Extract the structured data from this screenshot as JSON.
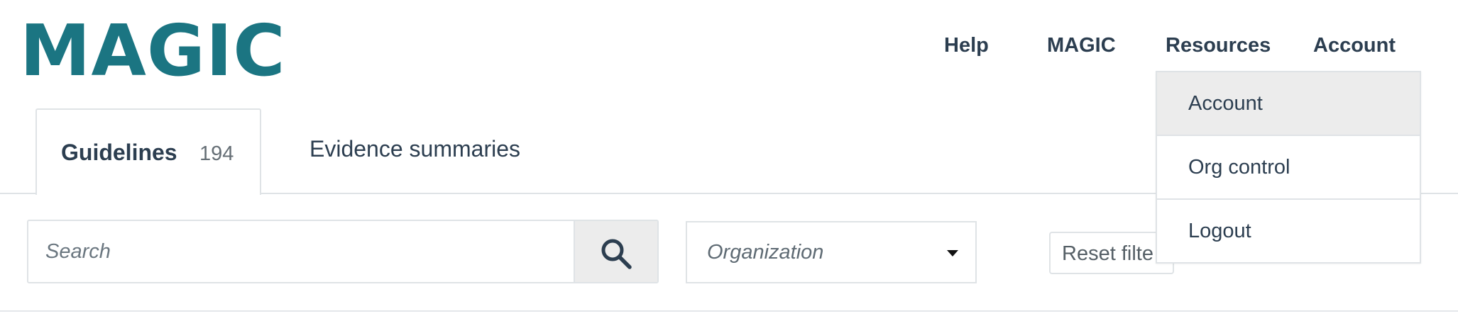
{
  "logo": {
    "text": "MAGIC"
  },
  "nav": {
    "help": "Help",
    "magic": "MAGIC",
    "resources": "Resources",
    "account": "Account"
  },
  "tabs": [
    {
      "label": "Guidelines",
      "count": "194",
      "active": true
    },
    {
      "label": "Evidence summaries",
      "active": false
    }
  ],
  "search": {
    "placeholder": "Search",
    "icon": "search-icon"
  },
  "organization": {
    "placeholder": "Organization",
    "icon": "caret-down-icon"
  },
  "reset": {
    "label": "Reset filte"
  },
  "account_menu": {
    "items": [
      {
        "label": "Account",
        "highlighted": true
      },
      {
        "label": "Org control",
        "highlighted": false
      },
      {
        "label": "Logout",
        "highlighted": false
      }
    ]
  },
  "colors": {
    "brand": "#1b7582",
    "text": "#2c3e50",
    "border": "#dfe3e6",
    "hover": "#ececec"
  }
}
